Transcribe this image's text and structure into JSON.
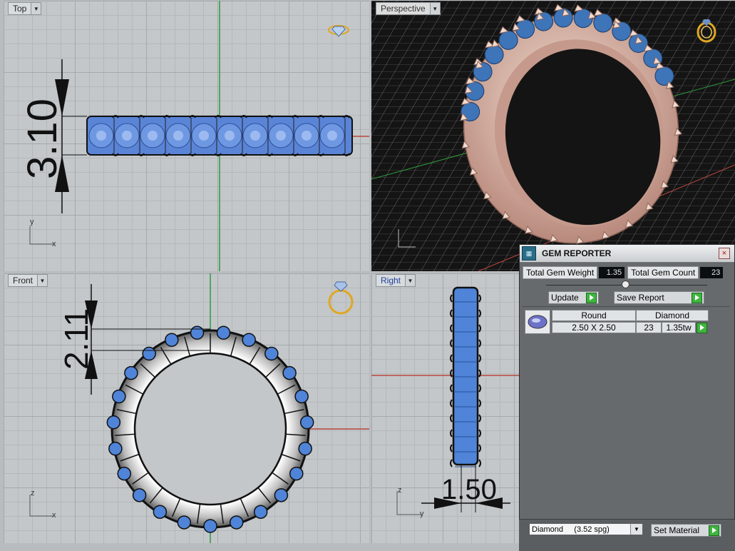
{
  "viewports": {
    "top": {
      "title": "Top",
      "dims": [
        "3.10"
      ],
      "axis_x": "x",
      "axis_y": "y"
    },
    "perspective": {
      "title": "Perspective"
    },
    "front": {
      "title": "Front",
      "dims": [
        "2.11"
      ],
      "axis_x": "x",
      "axis_y": "z"
    },
    "right": {
      "title": "Right",
      "dims": [
        "1.50"
      ],
      "axis_x": "y",
      "axis_y": "z"
    }
  },
  "gem_reporter": {
    "title": "GEM REPORTER",
    "close_icon": "×",
    "total_weight_label": "Total Gem Weight",
    "total_weight_value": "1.35",
    "total_count_label": "Total Gem Count",
    "total_count_value": "23",
    "update_label": "Update",
    "save_report_label": "Save Report",
    "table": {
      "headers": [
        "Round",
        "Diamond"
      ],
      "rows": [
        {
          "size": "2.50 X 2.50",
          "count": "23",
          "weight": "1.35tw"
        }
      ]
    },
    "material_select": "Diamond     (3.52 spg)",
    "set_material_label": "Set Material"
  },
  "colors": {
    "viewport_bg": "#c3c7ca",
    "perspective_bg": "#161616",
    "gem_blue": "#4f84d8",
    "metal_rose": "#e8c8b8",
    "panel_bg": "#666a6d"
  }
}
